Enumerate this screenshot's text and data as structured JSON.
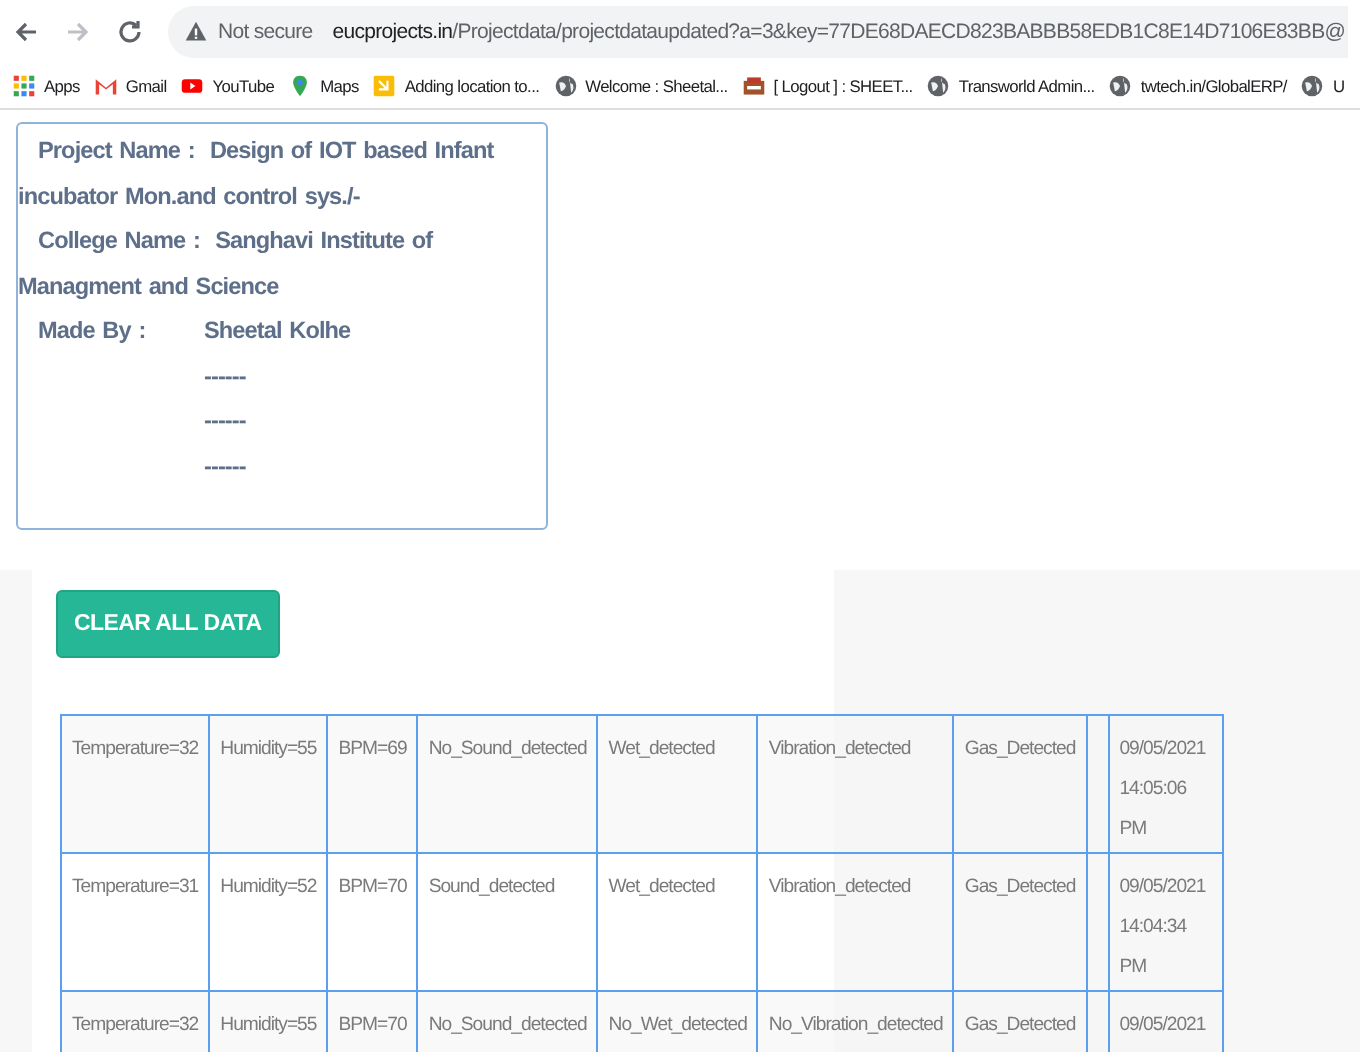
{
  "browser": {
    "security": "Not secure",
    "url_domain": "eucprojects.in",
    "url_path": "/Projectdata/projectdataupdated?a=3&key=77DE68DAECD823BABBB58EDB1C8E14D7106E83BB@",
    "bookmarks": [
      {
        "kind": "apps",
        "label": "Apps"
      },
      {
        "kind": "gmail",
        "label": "Gmail"
      },
      {
        "kind": "youtube",
        "label": "YouTube"
      },
      {
        "kind": "maps",
        "label": "Maps"
      },
      {
        "kind": "doc",
        "label": "Adding location to..."
      },
      {
        "kind": "globe",
        "label": "Welcome : Sheetal..."
      },
      {
        "kind": "site",
        "label": "[ Logout ] :  SHEET..."
      },
      {
        "kind": "globe",
        "label": "Transworld Admin..."
      },
      {
        "kind": "globe",
        "label": "twtech.in/GlobalERP/"
      },
      {
        "kind": "globe",
        "label": "U"
      }
    ]
  },
  "project": {
    "fields": [
      {
        "label": "Project Name :",
        "value": "Design of IOT based Infant incubator Mon.and control sys./-"
      },
      {
        "label": "College Name :",
        "value": "Sanghavi Institute of Managment and Science"
      },
      {
        "label": "Made By :",
        "value": "Sheetal Kolhe"
      },
      {
        "value": "------"
      },
      {
        "value": "------"
      },
      {
        "value": "------"
      }
    ]
  },
  "clear_button": "CLEAR ALL DATA",
  "table": {
    "rows": [
      [
        "Temperature=32",
        "Humidity=55",
        "BPM=69",
        "No_Sound_detected",
        "Wet_detected",
        "Vibration_detected",
        "Gas_Detected",
        "",
        "09/05/2021 14:05:06 PM"
      ],
      [
        "Temperature=31",
        "Humidity=52",
        "BPM=70",
        "Sound_detected",
        "Wet_detected",
        "Vibration_detected",
        "Gas_Detected",
        "",
        "09/05/2021 14:04:34 PM"
      ],
      [
        "Temperature=32",
        "Humidity=55",
        "BPM=70",
        "No_Sound_detected",
        "No_Wet_detected",
        "No_Vibration_detected",
        "Gas_Detected",
        "",
        "09/05/2021"
      ]
    ]
  }
}
